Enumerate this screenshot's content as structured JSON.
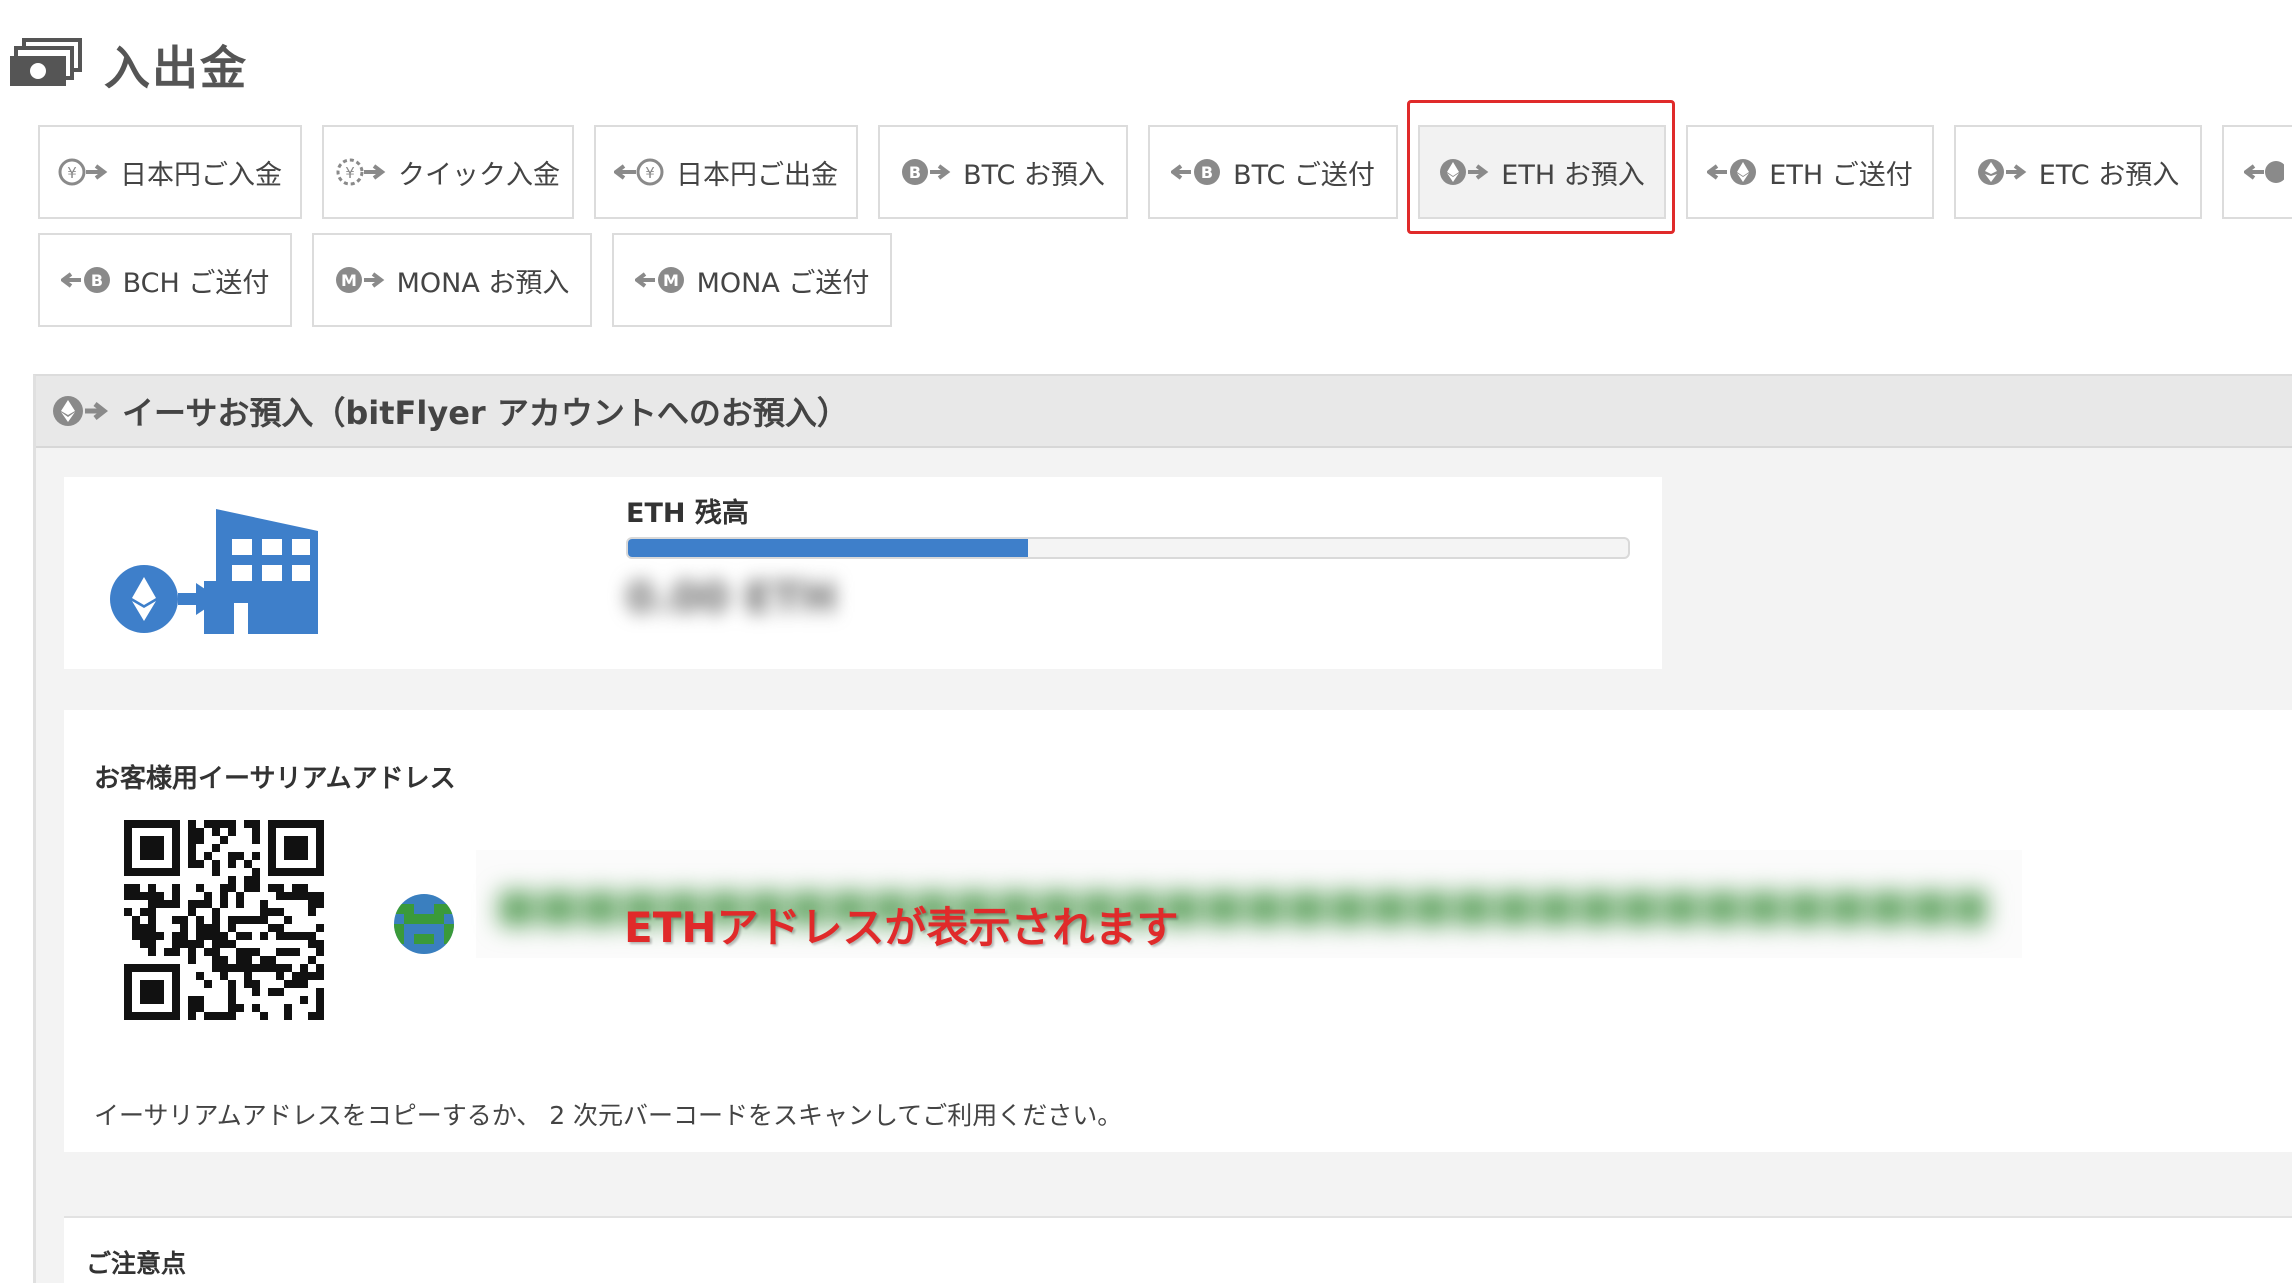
{
  "header": {
    "title": "入出金",
    "icon": "cash-icon"
  },
  "tabs": [
    {
      "id": "jpy-deposit",
      "label": "日本円ご入金",
      "icon": "yen-in-icon"
    },
    {
      "id": "quick-deposit",
      "label": "クイック入金",
      "icon": "yen-quick-icon"
    },
    {
      "id": "jpy-withdraw",
      "label": "日本円ご出金",
      "icon": "yen-out-icon"
    },
    {
      "id": "btc-deposit",
      "label": "BTC お預入",
      "icon": "btc-in-icon"
    },
    {
      "id": "btc-send",
      "label": "BTC ご送付",
      "icon": "btc-out-icon"
    },
    {
      "id": "eth-deposit",
      "label": "ETH お預入",
      "icon": "eth-in-icon",
      "active": true
    },
    {
      "id": "eth-send",
      "label": "ETH ご送付",
      "icon": "eth-out-icon"
    },
    {
      "id": "etc-deposit",
      "label": "ETC お預入",
      "icon": "etc-in-icon"
    },
    {
      "id": "bch-send",
      "label": "BCH ご送付",
      "icon": "bch-out-icon"
    },
    {
      "id": "mona-deposit",
      "label": "MONA お預入",
      "icon": "mona-in-icon"
    },
    {
      "id": "mona-send",
      "label": "MONA ご送付",
      "icon": "mona-out-icon"
    }
  ],
  "panel": {
    "title": "イーサお預入（bitFlyer アカウントへのお預入）",
    "balance": {
      "label": "ETH 残高",
      "progress": 0.4,
      "value_blurred": "0.00 ETH"
    },
    "address": {
      "title": "お客様用イーサリアムアドレス",
      "annotation": "ETHアドレスが表示されます",
      "help": "イーサリアムアドレスをコピーするか、 2 次元バーコードをスキャンしてご利用ください。"
    },
    "notes": {
      "title": "ご注意点"
    }
  },
  "colors": {
    "accent": "#3e7fca",
    "highlight": "#e02a2a",
    "icon_gray": "#8a8a8a"
  }
}
